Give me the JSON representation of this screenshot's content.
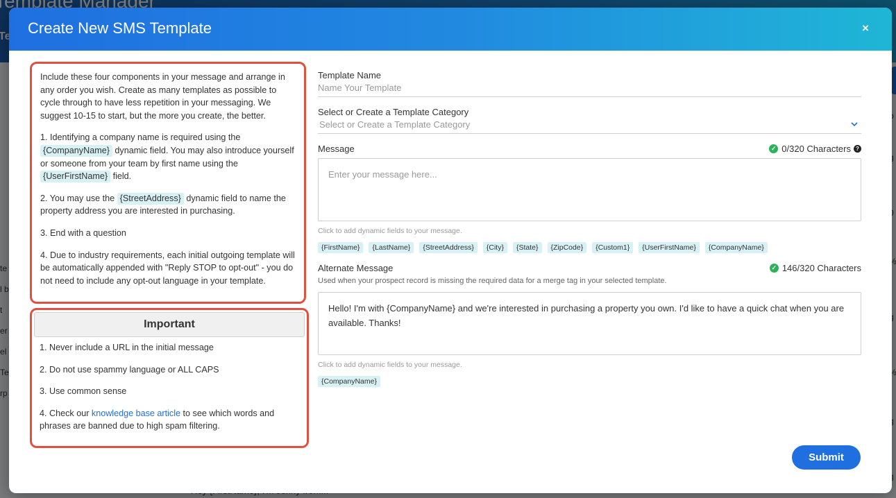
{
  "background": {
    "app_title": "Template Manager",
    "tab_label": "Te",
    "left_fragments": [
      "te",
      "l b",
      "t",
      "er",
      "el",
      "Te",
      "rp"
    ],
    "right_fragments": [
      "p",
      "g",
      "0",
      "%",
      "g",
      "%",
      "g",
      "g"
    ],
    "bottom_text": "Hey {FirstName}, I'm Jenny from..."
  },
  "modal": {
    "title": "Create New SMS Template",
    "close_label": "×"
  },
  "instructions": {
    "intro": "Include these four components in your message and arrange in any order you wish. Create as many templates as possible to cycle through to have less repetition in your messaging. We suggest 10-15 to start, but the more you create, the better.",
    "item1_pre": "1. Identifying a company name is required using the",
    "item1_tag1": "{CompanyName}",
    "item1_mid": "dynamic field. You may also introduce yourself or someone from your team by first name using the",
    "item1_tag2": "{UserFirstName}",
    "item1_post": "field.",
    "item2_pre": "2. You may use the",
    "item2_tag": "{StreetAddress}",
    "item2_post": "dynamic field to name the property address you are interested in purchasing.",
    "item3": "3. End with a question",
    "item4": "4. Due to industry requirements, each initial outgoing template will be automatically appended with \"Reply STOP to opt-out\" - you do not need to include any opt-out language in your template."
  },
  "important": {
    "title": "Important",
    "item1": "1. Never include a URL in the initial message",
    "item2": "2. Do not use spammy language or ALL CAPS",
    "item3": "3. Use common sense",
    "item4_pre": "4. Check our",
    "item4_link": "knowledge base article",
    "item4_post": "to see which words and phrases are banned due to high spam filtering."
  },
  "form": {
    "template_name_label": "Template Name",
    "template_name_placeholder": "Name Your Template",
    "category_label": "Select or Create a Template Category",
    "category_placeholder": "Select or Create a Template Category",
    "message_label": "Message",
    "message_counter": "0/320 Characters",
    "message_placeholder": "Enter your message here...",
    "message_hint": "Click to add dynamic fields to your message.",
    "dynamic_fields": [
      "{FirstName}",
      "{LastName}",
      "{StreetAddress}",
      "{City}",
      "{State}",
      "{ZipCode}",
      "{Custom1}",
      "{UserFirstName}",
      "{CompanyName}"
    ],
    "alt_label": "Alternate Message",
    "alt_counter": "146/320 Characters",
    "alt_sub": "Used when your prospect record is missing the required data for a merge tag in your selected template.",
    "alt_value": "Hello! I'm with {CompanyName} and we're interested in purchasing a property you own. I'd like to have a quick chat when you are available. Thanks!",
    "alt_hint": "Click to add dynamic fields to your message.",
    "alt_dynamic_fields": [
      "{CompanyName}"
    ],
    "submit_label": "Submit"
  },
  "colors": {
    "accent": "#1f6fe0",
    "highlight_border": "#e0503f",
    "tag_bg": "#d8f1f4",
    "success": "#2cb35a"
  },
  "icons": {
    "close": "close-icon",
    "chevron": "chevron-down-icon",
    "check": "check-circle-icon",
    "help": "help-circle-icon"
  }
}
